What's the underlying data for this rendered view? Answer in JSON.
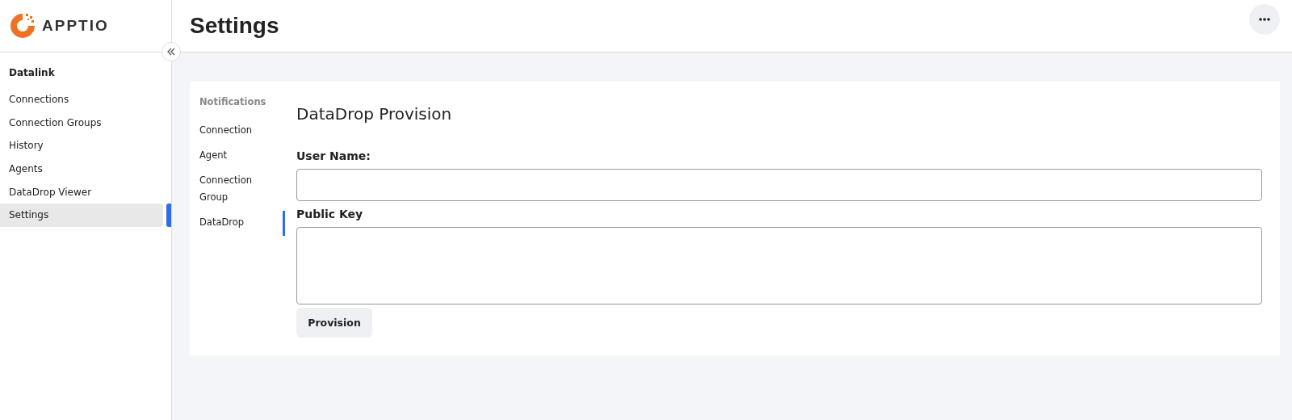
{
  "logo": {
    "text": "APPTIO"
  },
  "sidebar": {
    "section": "Datalink",
    "items": [
      {
        "label": "Connections",
        "selected": false
      },
      {
        "label": "Connection Groups",
        "selected": false
      },
      {
        "label": "History",
        "selected": false
      },
      {
        "label": "Agents",
        "selected": false
      },
      {
        "label": "DataDrop Viewer",
        "selected": false
      },
      {
        "label": "Settings",
        "selected": true
      }
    ]
  },
  "page": {
    "title": "Settings"
  },
  "settings_nav": {
    "heading": "Notifications",
    "items": [
      {
        "label": "Connection",
        "selected": false
      },
      {
        "label": "Agent",
        "selected": false
      },
      {
        "label": "Connection Group",
        "selected": false
      },
      {
        "label": "DataDrop",
        "selected": true
      }
    ]
  },
  "form": {
    "title": "DataDrop Provision",
    "fields": [
      {
        "label": "User Name:",
        "kind": "line"
      },
      {
        "label": "Public Key",
        "kind": "area"
      }
    ],
    "button": "Provision"
  }
}
